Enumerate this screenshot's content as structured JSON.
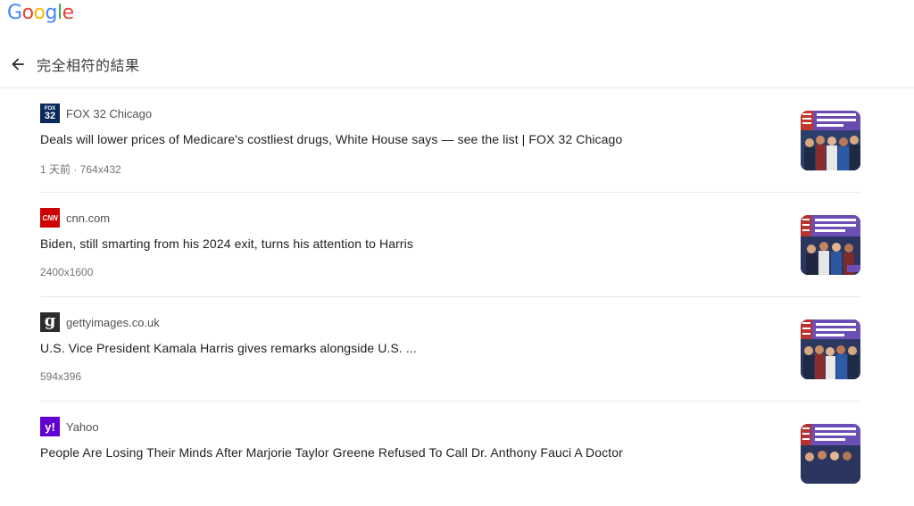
{
  "logo": {
    "letters": [
      {
        "char": "G",
        "color": "#4285f4"
      },
      {
        "char": "o",
        "color": "#ea4335"
      },
      {
        "char": "o",
        "color": "#fbbc05"
      },
      {
        "char": "g",
        "color": "#4285f4"
      },
      {
        "char": "l",
        "color": "#34a853"
      },
      {
        "char": "e",
        "color": "#ea4335"
      }
    ]
  },
  "header": {
    "back_icon": "arrow-back-icon",
    "title": "完全相符的結果"
  },
  "results": [
    {
      "source": "FOX 32 Chicago",
      "favicon": {
        "icon": "fox32-logo",
        "text_top": "FOX",
        "text_bottom": "32",
        "bg": "#0b2a5b",
        "color": "#ffffff"
      },
      "title": "Deals will lower prices of Medicare's costliest drugs, White House says — see the list | FOX 32 Chicago",
      "meta": "1 天前 · 764x432",
      "thumb_caption": "LOWERING PRESCRIPTION DRUG COSTS"
    },
    {
      "source": "cnn.com",
      "favicon": {
        "icon": "cnn-logo",
        "text": "CNN",
        "bg": "#cc0000",
        "color": "#ffffff"
      },
      "title": "Biden, still smarting from his 2024 exit, turns his attention to Harris",
      "meta": "2400x1600",
      "thumb_caption": "LOWERING PRESCRIPTION DRUG COSTS"
    },
    {
      "source": "gettyimages.co.uk",
      "favicon": {
        "icon": "gettyimages-logo",
        "text": "g",
        "bg": "#2b2b2b",
        "color": "#ffffff"
      },
      "title": "U.S. Vice President Kamala Harris gives remarks alongside U.S. ...",
      "meta": "594x396",
      "thumb_caption": "LOWERING PRESCRIPTION DRUG COSTS"
    },
    {
      "source": "Yahoo",
      "favicon": {
        "icon": "yahoo-logo",
        "text": "y!",
        "bg": "#6001d2",
        "color": "#ffffff"
      },
      "title": "People Are Losing Their Minds After Marjorie Taylor Greene Refused To Call Dr. Anthony Fauci A Doctor",
      "meta": "",
      "thumb_caption": "LOWERING PRESCRIPTION DRUG COSTS"
    }
  ]
}
